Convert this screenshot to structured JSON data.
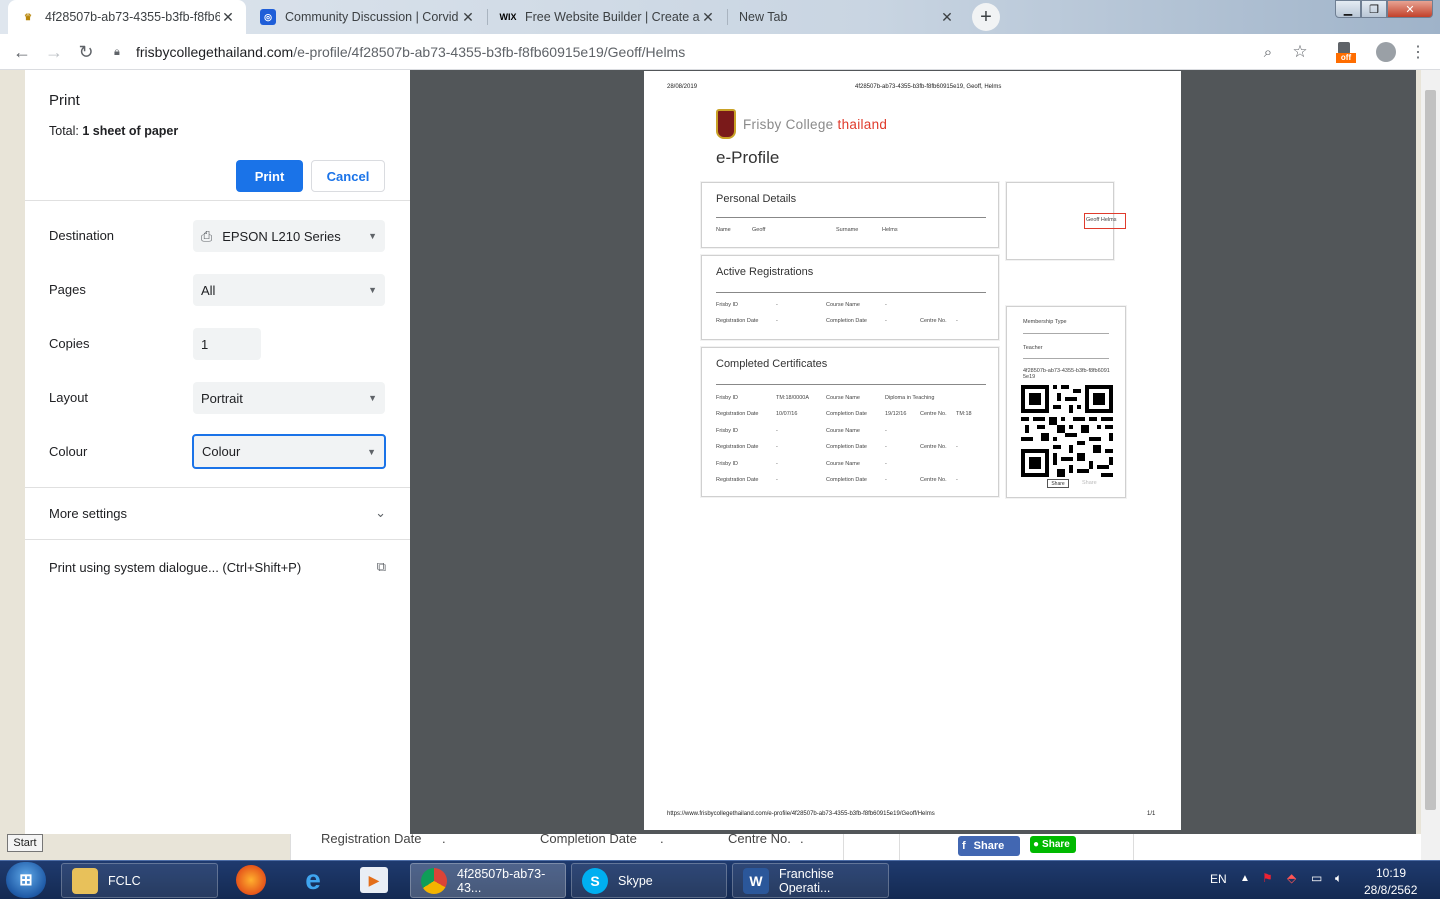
{
  "browser": {
    "tabs": [
      {
        "title": "4f28507b-ab73-4355-b3fb-f8fb6",
        "favicon": "crest-icon"
      },
      {
        "title": "Community Discussion | Corvid F",
        "favicon": "corvid-icon"
      },
      {
        "title": "Free Website Builder | Create a Fr",
        "favicon": "wix-icon"
      },
      {
        "title": "New Tab",
        "favicon": ""
      }
    ],
    "url_host": "frisbycollegethailand.com",
    "url_path": "/e-profile/4f28507b-ab73-4355-b3fb-f8fb60915e19/Geoff/Helms",
    "extension_badge": "off"
  },
  "print": {
    "title": "Print",
    "total_label": "Total:",
    "total_value": "1 sheet of paper",
    "print_button": "Print",
    "cancel_button": "Cancel",
    "destination_label": "Destination",
    "destination_value": "EPSON L210 Series",
    "pages_label": "Pages",
    "pages_value": "All",
    "copies_label": "Copies",
    "copies_value": "1",
    "layout_label": "Layout",
    "layout_value": "Portrait",
    "colour_label": "Colour",
    "colour_value": "Colour",
    "more_settings": "More settings",
    "system_dialog": "Print using system dialogue... (Ctrl+Shift+P)"
  },
  "preview": {
    "header_date": "28/08/2019",
    "header_title": "4f28507b-ab73-4355-b3fb-f8fb60915e19, Geoff, Helms",
    "brand_name": "Frisby College",
    "brand_country": "thailand",
    "page_title": "e-Profile",
    "personal": {
      "title": "Personal Details",
      "name_label": "Name",
      "name_value": "Geoff",
      "surname_label": "Surname",
      "surname_value": "Helms"
    },
    "photo_alt": "Geoff Helms",
    "active": {
      "title": "Active Registrations",
      "frisby_id": "Frisby ID",
      "course_name": "Course Name",
      "registration_date": "Registration Date",
      "completion_date": "Completion Date",
      "centre_no": "Centre No.",
      "dash": "-"
    },
    "completed": {
      "title": "Completed Certificates",
      "rows": [
        {
          "frisby_id": "Frisby ID",
          "id_value": "TM:18/0000A",
          "course_name": "Course Name",
          "course_value": "Diploma in Teaching",
          "registration_date": "Registration Date",
          "reg_value": "10/07/16",
          "completion_date": "Completion Date",
          "comp_value": "19/12/16",
          "centre_no": "Centre No.",
          "centre_value": "TM:18"
        },
        {
          "frisby_id": "Frisby ID",
          "id_value": "-",
          "course_name": "Course Name",
          "course_value": "-",
          "registration_date": "Registration Date",
          "reg_value": "-",
          "completion_date": "Completion Date",
          "comp_value": "-",
          "centre_no": "Centre No.",
          "centre_value": "-"
        },
        {
          "frisby_id": "Frisby ID",
          "id_value": "-",
          "course_name": "Course Name",
          "course_value": "-",
          "registration_date": "Registration Date",
          "reg_value": "-",
          "completion_date": "Completion Date",
          "comp_value": "-",
          "centre_no": "Centre No.",
          "centre_value": "-"
        }
      ]
    },
    "membership": {
      "type_label": "Membership Type",
      "type_value": "Teacher",
      "uuid": "4f28507b-ab73-4355-b3fb-f8fb60915e19",
      "share1": "Share",
      "share2": "Share"
    },
    "footer_url": "https://www.frisbycollegethailand.com/e-profile/4f28507b-ab73-4355-b3fb-f8fb60915e19/Geoff/Helms",
    "footer_page": "1/1"
  },
  "behind_page": {
    "registration_date": "Registration Date",
    "completion_date": "Completion Date",
    "centre_no": "Centre No.",
    "dot": ".",
    "fb_share": "Share",
    "line_share": "Share"
  },
  "taskbar": {
    "start_tooltip": "Start",
    "items": [
      {
        "label": "FCLC",
        "icon": "folder-icon"
      },
      {
        "label": "4f28507b-ab73-43...",
        "icon": "chrome-icon"
      },
      {
        "label": "Skype",
        "icon": "skype-icon"
      },
      {
        "label": "Franchise Operati...",
        "icon": "word-icon"
      }
    ],
    "language": "EN",
    "time": "10:19",
    "date": "28/8/2562"
  }
}
